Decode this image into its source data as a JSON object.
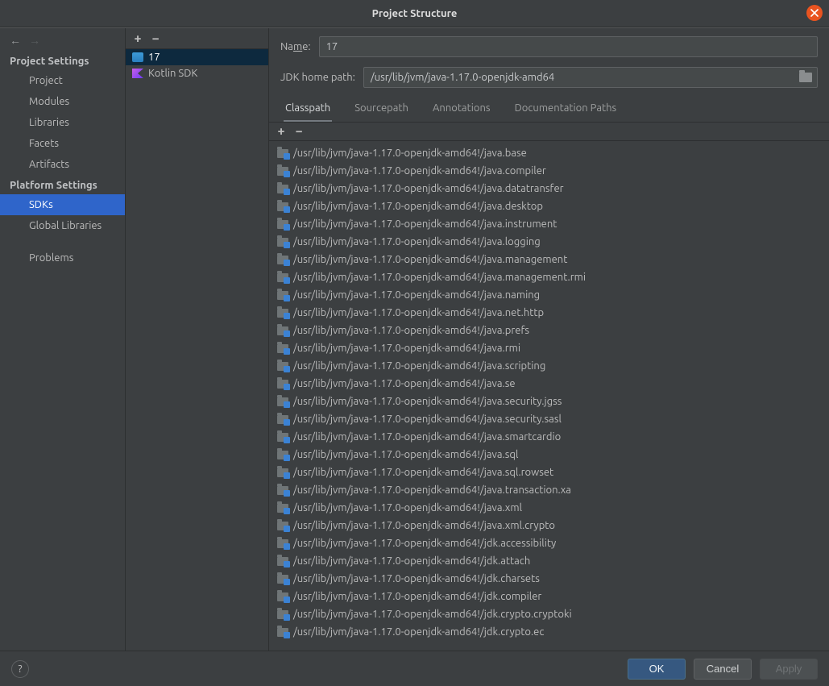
{
  "window": {
    "title": "Project Structure"
  },
  "sidebar": {
    "sections": [
      {
        "header": "Project Settings",
        "items": [
          "Project",
          "Modules",
          "Libraries",
          "Facets",
          "Artifacts"
        ]
      },
      {
        "header": "Platform Settings",
        "items": [
          "SDKs",
          "Global Libraries"
        ]
      }
    ],
    "problems_label": "Problems",
    "selected": "SDKs"
  },
  "sdk_list": {
    "items": [
      {
        "name": "17",
        "kind": "java"
      },
      {
        "name": "Kotlin SDK",
        "kind": "kotlin"
      }
    ],
    "selected_index": 0
  },
  "details": {
    "name_label_pre": "Na",
    "name_label_mn": "m",
    "name_label_post": "e:",
    "name_value": "17",
    "jdk_home_label": "JDK home path:",
    "jdk_home_value": "/usr/lib/jvm/java-1.17.0-openjdk-amd64",
    "tabs": [
      "Classpath",
      "Sourcepath",
      "Annotations",
      "Documentation Paths"
    ],
    "active_tab": 0,
    "classpath": [
      "/usr/lib/jvm/java-1.17.0-openjdk-amd64!/java.base",
      "/usr/lib/jvm/java-1.17.0-openjdk-amd64!/java.compiler",
      "/usr/lib/jvm/java-1.17.0-openjdk-amd64!/java.datatransfer",
      "/usr/lib/jvm/java-1.17.0-openjdk-amd64!/java.desktop",
      "/usr/lib/jvm/java-1.17.0-openjdk-amd64!/java.instrument",
      "/usr/lib/jvm/java-1.17.0-openjdk-amd64!/java.logging",
      "/usr/lib/jvm/java-1.17.0-openjdk-amd64!/java.management",
      "/usr/lib/jvm/java-1.17.0-openjdk-amd64!/java.management.rmi",
      "/usr/lib/jvm/java-1.17.0-openjdk-amd64!/java.naming",
      "/usr/lib/jvm/java-1.17.0-openjdk-amd64!/java.net.http",
      "/usr/lib/jvm/java-1.17.0-openjdk-amd64!/java.prefs",
      "/usr/lib/jvm/java-1.17.0-openjdk-amd64!/java.rmi",
      "/usr/lib/jvm/java-1.17.0-openjdk-amd64!/java.scripting",
      "/usr/lib/jvm/java-1.17.0-openjdk-amd64!/java.se",
      "/usr/lib/jvm/java-1.17.0-openjdk-amd64!/java.security.jgss",
      "/usr/lib/jvm/java-1.17.0-openjdk-amd64!/java.security.sasl",
      "/usr/lib/jvm/java-1.17.0-openjdk-amd64!/java.smartcardio",
      "/usr/lib/jvm/java-1.17.0-openjdk-amd64!/java.sql",
      "/usr/lib/jvm/java-1.17.0-openjdk-amd64!/java.sql.rowset",
      "/usr/lib/jvm/java-1.17.0-openjdk-amd64!/java.transaction.xa",
      "/usr/lib/jvm/java-1.17.0-openjdk-amd64!/java.xml",
      "/usr/lib/jvm/java-1.17.0-openjdk-amd64!/java.xml.crypto",
      "/usr/lib/jvm/java-1.17.0-openjdk-amd64!/jdk.accessibility",
      "/usr/lib/jvm/java-1.17.0-openjdk-amd64!/jdk.attach",
      "/usr/lib/jvm/java-1.17.0-openjdk-amd64!/jdk.charsets",
      "/usr/lib/jvm/java-1.17.0-openjdk-amd64!/jdk.compiler",
      "/usr/lib/jvm/java-1.17.0-openjdk-amd64!/jdk.crypto.cryptoki",
      "/usr/lib/jvm/java-1.17.0-openjdk-amd64!/jdk.crypto.ec"
    ]
  },
  "buttons": {
    "help": "?",
    "ok": "OK",
    "cancel": "Cancel",
    "apply": "Apply"
  }
}
